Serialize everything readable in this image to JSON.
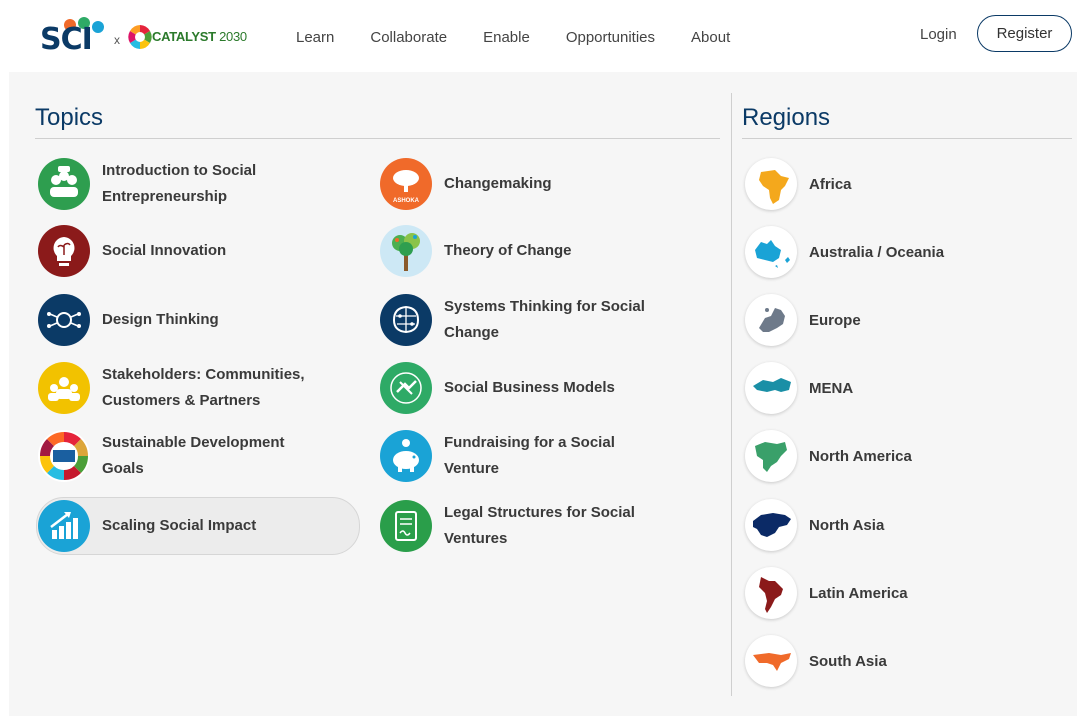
{
  "header": {
    "logo_sci": "SCI",
    "logo_x": "x",
    "logo_catalyst": "CATALYST",
    "logo_year": "2030",
    "nav": [
      "Learn",
      "Collaborate",
      "Enable",
      "Opportunities",
      "About"
    ],
    "login": "Login",
    "register": "Register"
  },
  "topics": {
    "title": "Topics",
    "items": [
      {
        "label": "Introduction to Social Entrepreneurship",
        "icon": "people-meeting-icon",
        "color": "#2e9e4f"
      },
      {
        "label": "Social Innovation",
        "icon": "lightbulb-sprout-icon",
        "color": "#8b1a1a"
      },
      {
        "label": "Design Thinking",
        "icon": "circuit-brain-icon",
        "color": "#0b3a66"
      },
      {
        "label": "Stakeholders: Communities, Customers & Partners",
        "icon": "stakeholders-icon",
        "color": "#f2c200"
      },
      {
        "label": "Sustainable Development Goals",
        "icon": "sdg-wheel-icon",
        "color": "#ffffff"
      },
      {
        "label": "Scaling Social Impact",
        "icon": "growth-chart-icon",
        "color": "#1aa3d6"
      },
      {
        "label": "Changemaking",
        "icon": "ashoka-tree-icon",
        "color": "#f06a2a",
        "badge": "ASHOKA"
      },
      {
        "label": "Theory of Change",
        "icon": "tree-icon",
        "color": "#cde8f5"
      },
      {
        "label": "Systems Thinking for Social Change",
        "icon": "brain-network-icon",
        "color": "#0b3a66"
      },
      {
        "label": "Social Business Models",
        "icon": "handshake-icon",
        "color": "#2eaa66"
      },
      {
        "label": "Fundraising for a Social Venture",
        "icon": "piggy-bank-icon",
        "color": "#1aa3d6"
      },
      {
        "label": "Legal Structures for Social Ventures",
        "icon": "legal-document-icon",
        "color": "#2a9e4a"
      }
    ]
  },
  "regions": {
    "title": "Regions",
    "items": [
      {
        "label": "Africa",
        "icon": "africa-map-icon",
        "color": "#f4a81c"
      },
      {
        "label": "Australia / Oceania",
        "icon": "australia-map-icon",
        "color": "#1aa3d6"
      },
      {
        "label": "Europe",
        "icon": "europe-map-icon",
        "color": "#6e7a8a"
      },
      {
        "label": "MENA",
        "icon": "mena-map-icon",
        "color": "#1a8fa6"
      },
      {
        "label": "North America",
        "icon": "north-america-map-icon",
        "color": "#3aa06a"
      },
      {
        "label": "North Asia",
        "icon": "north-asia-map-icon",
        "color": "#0b2a66"
      },
      {
        "label": "Latin America",
        "icon": "latin-america-map-icon",
        "color": "#8b1a1a"
      },
      {
        "label": "South Asia",
        "icon": "south-asia-map-icon",
        "color": "#f06a2a"
      }
    ]
  }
}
